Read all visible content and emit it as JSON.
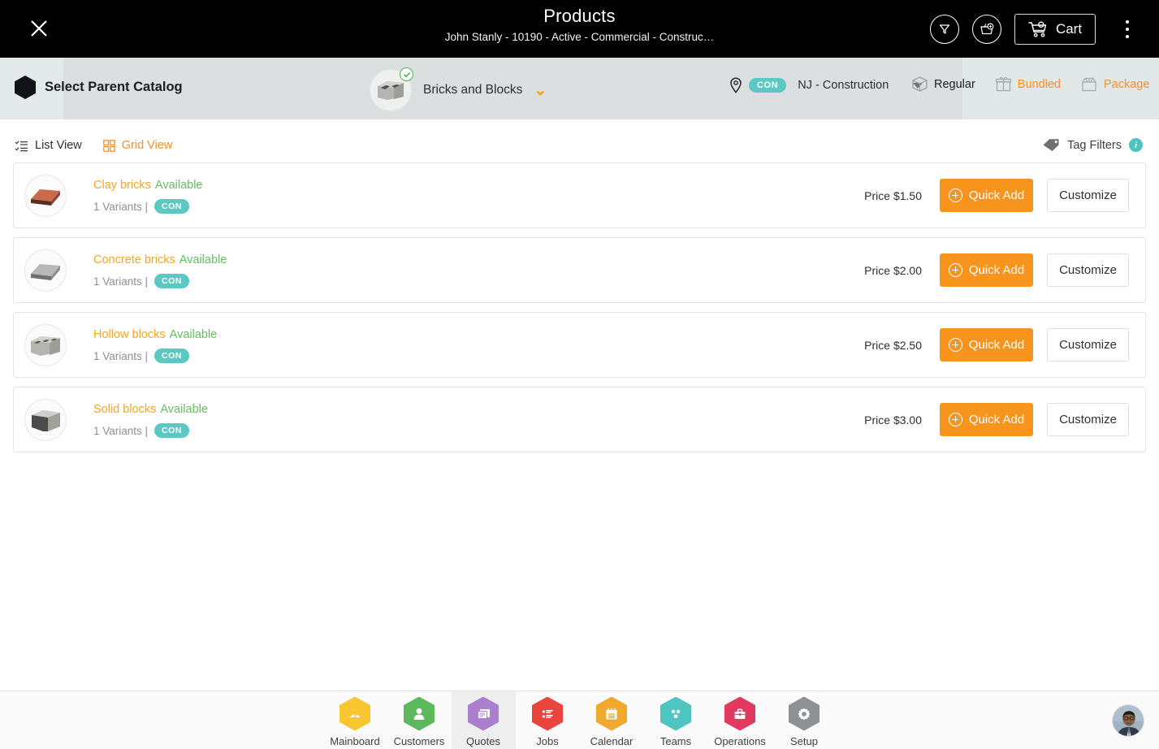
{
  "header": {
    "title": "Products",
    "subtitle": "John Stanly - 10190 - Active - Commercial - Construc…",
    "close_icon": "close-icon",
    "filter_icon": "filter-funnel-icon",
    "basket_icon": "add-to-basket-icon",
    "cart_label": "Cart",
    "cart_icon": "shopping-cart-icon",
    "menu_icon": "kebab-menu-icon",
    "background": "#000000"
  },
  "catalog_bar": {
    "parent_catalog_label": "Select Parent Catalog",
    "parent_catalog_icon": "hexagon-icon",
    "selected_catalog": "Bricks and Blocks",
    "catalog_thumb_icon": "hollow-block-thumbnail",
    "catalog_check_icon": "check-badge-icon",
    "catalog_chevron_icon": "chevron-down-icon",
    "location_icon": "map-pin-icon",
    "location_badge": "CON",
    "location_name": "NJ - Construction",
    "location_caret_icon": "caret-down-icon",
    "types": [
      {
        "label": "Regular",
        "icon": "box-icon",
        "active": true
      },
      {
        "label": "Bundled",
        "icon": "gift-icon",
        "active": false
      },
      {
        "label": "Package",
        "icon": "package-icon",
        "active": false
      }
    ],
    "accent_orange": "#f5902a",
    "badge_teal": "#5cc8c4"
  },
  "view_row": {
    "list_view_label": "List View",
    "list_view_icon": "list-view-icon",
    "grid_view_label": "Grid View",
    "grid_view_icon": "grid-view-icon",
    "active_view": "List View",
    "tag_filters_label": "Tag Filters",
    "tag_filters_icon": "tag-icon",
    "tag_filters_info_icon": "info-icon",
    "info_char": "i"
  },
  "products": [
    {
      "name": "Clay bricks",
      "status": "Available",
      "variants": "1 Variants |",
      "badge": "CON",
      "price": "Price $1.50",
      "quick_add_label": "Quick Add",
      "customize_label": "Customize",
      "thumb_icon": "clay-brick-thumbnail",
      "thumb_colors": {
        "top": "#c96a4d",
        "front": "#a9533b",
        "side": "#5a2d22"
      }
    },
    {
      "name": "Concrete bricks",
      "status": "Available",
      "variants": "1 Variants |",
      "badge": "CON",
      "price": "Price $2.00",
      "quick_add_label": "Quick Add",
      "customize_label": "Customize",
      "thumb_icon": "concrete-brick-thumbnail",
      "thumb_colors": {
        "top": "#b8b8b6",
        "front": "#8e8e8c",
        "side": "#6f6f6d"
      }
    },
    {
      "name": "Hollow blocks",
      "status": "Available",
      "variants": "1 Variants |",
      "badge": "CON",
      "price": "Price $2.50",
      "quick_add_label": "Quick Add",
      "customize_label": "Customize",
      "thumb_icon": "hollow-block-thumbnail",
      "thumb_colors": {
        "top": "#c7c7c4",
        "front": "#a6a6a3",
        "side": "#8a8a87"
      }
    },
    {
      "name": "Solid blocks",
      "status": "Available",
      "variants": "1 Variants |",
      "badge": "CON",
      "price": "Price $3.00",
      "quick_add_label": "Quick Add",
      "customize_label": "Customize",
      "thumb_icon": "solid-block-thumbnail",
      "thumb_colors": {
        "top": "#c9c9c6",
        "front": "#4b4b4b",
        "side": "#9b9b98"
      }
    }
  ],
  "bottom_nav": {
    "items": [
      {
        "label": "Mainboard",
        "icon": "dashboard-icon",
        "color": "#f8c630",
        "active": false
      },
      {
        "label": "Customers",
        "icon": "person-icon",
        "color": "#5cb85c",
        "active": false
      },
      {
        "label": "Quotes",
        "icon": "quotes-icon",
        "color": "#a97fce",
        "active": true
      },
      {
        "label": "Jobs",
        "icon": "tasklist-icon",
        "color": "#e8453c",
        "active": false
      },
      {
        "label": "Calendar",
        "icon": "calendar-icon",
        "color": "#f0a92c",
        "active": false
      },
      {
        "label": "Teams",
        "icon": "teams-icon",
        "color": "#4ec5c1",
        "active": false
      },
      {
        "label": "Operations",
        "icon": "briefcase-icon",
        "color": "#e03a5f",
        "active": false
      },
      {
        "label": "Setup",
        "icon": "gear-icon",
        "color": "#8e9093",
        "active": false
      }
    ],
    "avatar_icon": "user-avatar"
  }
}
